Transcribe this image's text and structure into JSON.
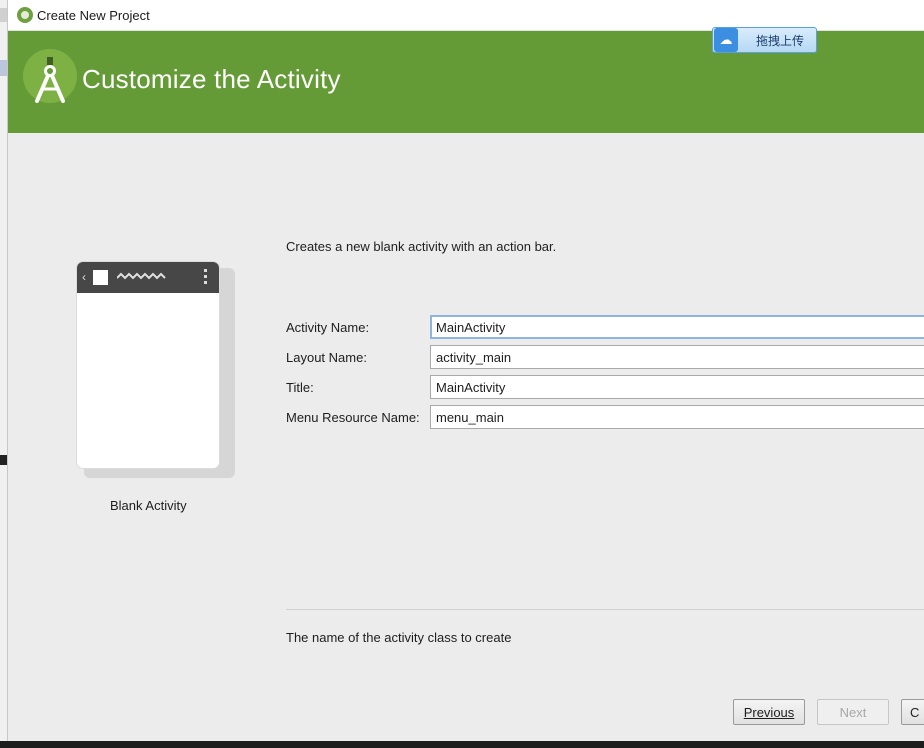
{
  "window": {
    "title": "Create New Project"
  },
  "banner": {
    "title": "Customize the Activity",
    "upload_button_label": "拖拽上传",
    "color": "#659b37"
  },
  "preview": {
    "caption": "Blank Activity"
  },
  "description": "Creates a new blank activity with an action bar.",
  "form": {
    "fields": [
      {
        "label": "Activity Name:",
        "value": "MainActivity"
      },
      {
        "label": "Layout Name:",
        "value": "activity_main"
      },
      {
        "label": "Title:",
        "value": "MainActivity"
      },
      {
        "label": "Menu Resource Name:",
        "value": "menu_main"
      }
    ]
  },
  "help_text": "The name of the activity class to create",
  "buttons": {
    "previous": "Previous",
    "next": "Next",
    "cancel": "C"
  }
}
